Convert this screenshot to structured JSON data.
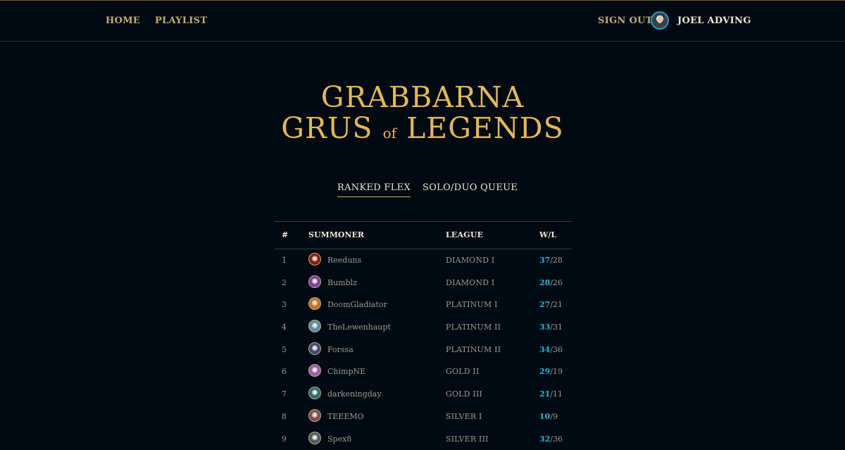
{
  "nav": {
    "home": "HOME",
    "playlist": "PLAYLIST",
    "sign_out": "SIGN OUT",
    "user": "JOEL ADVING"
  },
  "title": {
    "line1": "GRABBARNA",
    "line2a": "GRUS",
    "of": "of",
    "line2b": "LEGENDS"
  },
  "tabs": [
    {
      "label": "RANKED FLEX",
      "active": true
    },
    {
      "label": "SOLO/DUO QUEUE",
      "active": false
    }
  ],
  "table": {
    "headers": {
      "rank": "#",
      "summoner": "SUMMONER",
      "league": "LEAGUE",
      "wl": "W/L"
    },
    "rows": [
      {
        "rank": "1",
        "summoner": "Reeduns",
        "league": "DIAMOND I",
        "wins": "37",
        "sep": "/",
        "losses": "28",
        "icon_color": "#8b1a1a"
      },
      {
        "rank": "2",
        "summoner": "Bumblz",
        "league": "DIAMOND I",
        "wins": "28",
        "sep": "/",
        "losses": "26",
        "icon_color": "#7a3ea0"
      },
      {
        "rank": "3",
        "summoner": "DoomGladiator",
        "league": "PLATINUM I",
        "wins": "27",
        "sep": "/",
        "losses": "21",
        "icon_color": "#c0702a"
      },
      {
        "rank": "4",
        "summoner": "TheLewenhaupt",
        "league": "PLATINUM II",
        "wins": "33",
        "sep": "/",
        "losses": "31",
        "icon_color": "#5a8ab0"
      },
      {
        "rank": "5",
        "summoner": "Forssa",
        "league": "PLATINUM II",
        "wins": "34",
        "sep": "/",
        "losses": "36",
        "icon_color": "#3a4a7a"
      },
      {
        "rank": "6",
        "summoner": "ChimpNE",
        "league": "GOLD II",
        "wins": "29",
        "sep": "/",
        "losses": "19",
        "icon_color": "#9a5ab0"
      },
      {
        "rank": "7",
        "summoner": "darkeningday",
        "league": "GOLD III",
        "wins": "21",
        "sep": "/",
        "losses": "11",
        "icon_color": "#2a6a7a"
      },
      {
        "rank": "8",
        "summoner": "TEEEMO",
        "league": "SILVER I",
        "wins": "10",
        "sep": "/",
        "losses": "9",
        "icon_color": "#7a4a5a"
      },
      {
        "rank": "9",
        "summoner": "Spex8",
        "league": "SILVER III",
        "wins": "32",
        "sep": "/",
        "losses": "36",
        "icon_color": "#4a5a6a"
      }
    ]
  }
}
